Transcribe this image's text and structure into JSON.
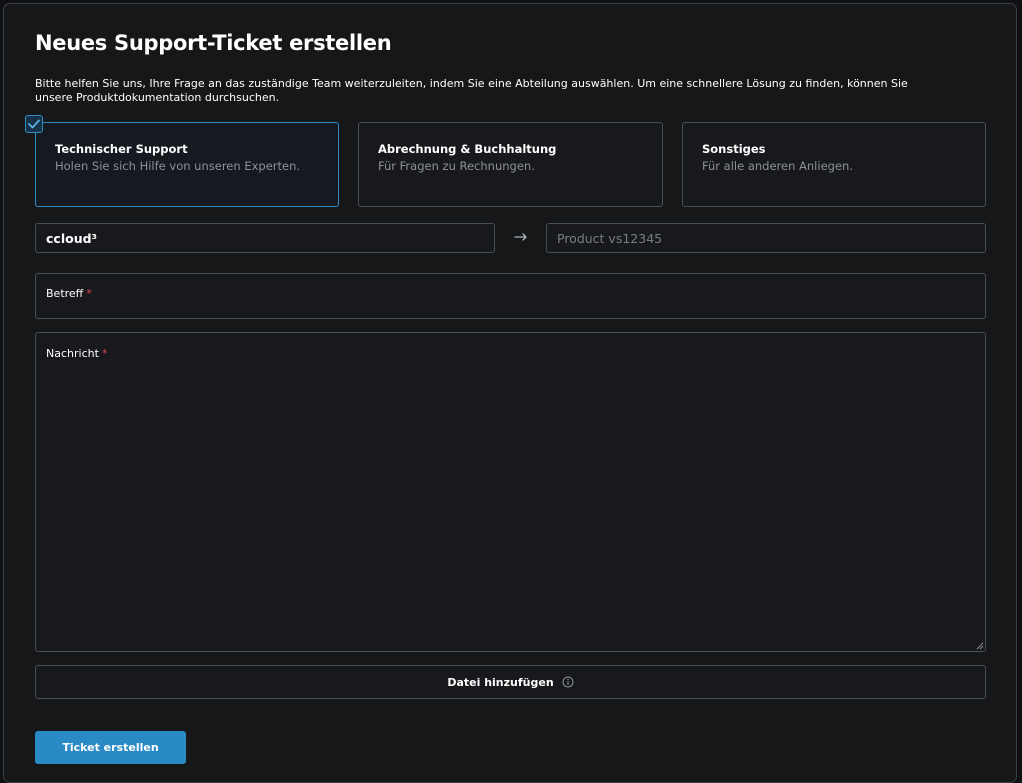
{
  "form": {
    "title": "Neues Support-Ticket erstellen",
    "intro": "Bitte helfen Sie uns, Ihre Frage an das zuständige Team weiterzuleiten, indem Sie eine Abteilung auswählen. Um eine schnellere Lösung zu finden, können Sie unsere Produktdokumentation durchsuchen."
  },
  "departments": [
    {
      "title": "Technischer Support",
      "description": "Holen Sie sich Hilfe von unseren Experten.",
      "selected": true
    },
    {
      "title": "Abrechnung & Buchhaltung",
      "description": "Für Fragen zu Rechnungen.",
      "selected": false
    },
    {
      "title": "Sonstiges",
      "description": "Für alle anderen Anliegen.",
      "selected": false
    }
  ],
  "product": {
    "selected_value": "ccloud³",
    "arrow_icon": "arrow-right-icon",
    "input_placeholder": "Product vs12345"
  },
  "fields": {
    "subject_label": "Betreff",
    "message_label": "Nachricht",
    "required_marker": "*"
  },
  "attachment": {
    "label": "Datei hinzufügen",
    "icon": "info-icon"
  },
  "submit": {
    "label": "Ticket erstellen"
  },
  "colors": {
    "accent": "#2a8ac6",
    "background": "#151719",
    "required": "#e0454c"
  }
}
